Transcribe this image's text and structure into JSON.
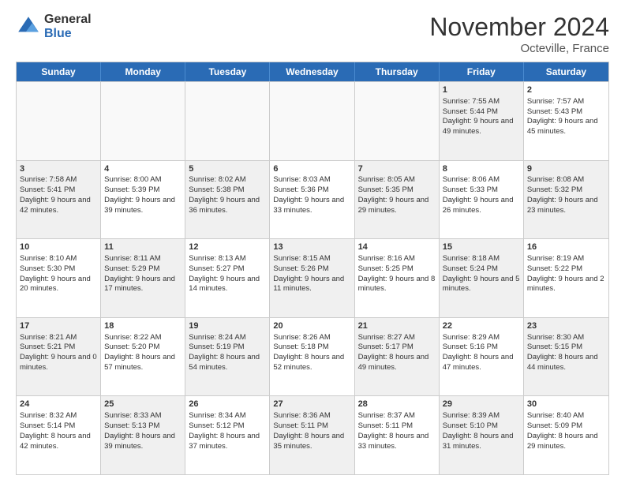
{
  "logo": {
    "general": "General",
    "blue": "Blue"
  },
  "header": {
    "month": "November 2024",
    "location": "Octeville, France"
  },
  "weekdays": [
    "Sunday",
    "Monday",
    "Tuesday",
    "Wednesday",
    "Thursday",
    "Friday",
    "Saturday"
  ],
  "rows": [
    [
      {
        "day": "",
        "info": "",
        "empty": true
      },
      {
        "day": "",
        "info": "",
        "empty": true
      },
      {
        "day": "",
        "info": "",
        "empty": true
      },
      {
        "day": "",
        "info": "",
        "empty": true
      },
      {
        "day": "",
        "info": "",
        "empty": true
      },
      {
        "day": "1",
        "info": "Sunrise: 7:55 AM\nSunset: 5:44 PM\nDaylight: 9 hours and 49 minutes.",
        "shaded": true
      },
      {
        "day": "2",
        "info": "Sunrise: 7:57 AM\nSunset: 5:43 PM\nDaylight: 9 hours and 45 minutes.",
        "shaded": false
      }
    ],
    [
      {
        "day": "3",
        "info": "Sunrise: 7:58 AM\nSunset: 5:41 PM\nDaylight: 9 hours and 42 minutes.",
        "shaded": true
      },
      {
        "day": "4",
        "info": "Sunrise: 8:00 AM\nSunset: 5:39 PM\nDaylight: 9 hours and 39 minutes.",
        "shaded": false
      },
      {
        "day": "5",
        "info": "Sunrise: 8:02 AM\nSunset: 5:38 PM\nDaylight: 9 hours and 36 minutes.",
        "shaded": true
      },
      {
        "day": "6",
        "info": "Sunrise: 8:03 AM\nSunset: 5:36 PM\nDaylight: 9 hours and 33 minutes.",
        "shaded": false
      },
      {
        "day": "7",
        "info": "Sunrise: 8:05 AM\nSunset: 5:35 PM\nDaylight: 9 hours and 29 minutes.",
        "shaded": true
      },
      {
        "day": "8",
        "info": "Sunrise: 8:06 AM\nSunset: 5:33 PM\nDaylight: 9 hours and 26 minutes.",
        "shaded": false
      },
      {
        "day": "9",
        "info": "Sunrise: 8:08 AM\nSunset: 5:32 PM\nDaylight: 9 hours and 23 minutes.",
        "shaded": true
      }
    ],
    [
      {
        "day": "10",
        "info": "Sunrise: 8:10 AM\nSunset: 5:30 PM\nDaylight: 9 hours and 20 minutes.",
        "shaded": false
      },
      {
        "day": "11",
        "info": "Sunrise: 8:11 AM\nSunset: 5:29 PM\nDaylight: 9 hours and 17 minutes.",
        "shaded": true
      },
      {
        "day": "12",
        "info": "Sunrise: 8:13 AM\nSunset: 5:27 PM\nDaylight: 9 hours and 14 minutes.",
        "shaded": false
      },
      {
        "day": "13",
        "info": "Sunrise: 8:15 AM\nSunset: 5:26 PM\nDaylight: 9 hours and 11 minutes.",
        "shaded": true
      },
      {
        "day": "14",
        "info": "Sunrise: 8:16 AM\nSunset: 5:25 PM\nDaylight: 9 hours and 8 minutes.",
        "shaded": false
      },
      {
        "day": "15",
        "info": "Sunrise: 8:18 AM\nSunset: 5:24 PM\nDaylight: 9 hours and 5 minutes.",
        "shaded": true
      },
      {
        "day": "16",
        "info": "Sunrise: 8:19 AM\nSunset: 5:22 PM\nDaylight: 9 hours and 2 minutes.",
        "shaded": false
      }
    ],
    [
      {
        "day": "17",
        "info": "Sunrise: 8:21 AM\nSunset: 5:21 PM\nDaylight: 9 hours and 0 minutes.",
        "shaded": true
      },
      {
        "day": "18",
        "info": "Sunrise: 8:22 AM\nSunset: 5:20 PM\nDaylight: 8 hours and 57 minutes.",
        "shaded": false
      },
      {
        "day": "19",
        "info": "Sunrise: 8:24 AM\nSunset: 5:19 PM\nDaylight: 8 hours and 54 minutes.",
        "shaded": true
      },
      {
        "day": "20",
        "info": "Sunrise: 8:26 AM\nSunset: 5:18 PM\nDaylight: 8 hours and 52 minutes.",
        "shaded": false
      },
      {
        "day": "21",
        "info": "Sunrise: 8:27 AM\nSunset: 5:17 PM\nDaylight: 8 hours and 49 minutes.",
        "shaded": true
      },
      {
        "day": "22",
        "info": "Sunrise: 8:29 AM\nSunset: 5:16 PM\nDaylight: 8 hours and 47 minutes.",
        "shaded": false
      },
      {
        "day": "23",
        "info": "Sunrise: 8:30 AM\nSunset: 5:15 PM\nDaylight: 8 hours and 44 minutes.",
        "shaded": true
      }
    ],
    [
      {
        "day": "24",
        "info": "Sunrise: 8:32 AM\nSunset: 5:14 PM\nDaylight: 8 hours and 42 minutes.",
        "shaded": false
      },
      {
        "day": "25",
        "info": "Sunrise: 8:33 AM\nSunset: 5:13 PM\nDaylight: 8 hours and 39 minutes.",
        "shaded": true
      },
      {
        "day": "26",
        "info": "Sunrise: 8:34 AM\nSunset: 5:12 PM\nDaylight: 8 hours and 37 minutes.",
        "shaded": false
      },
      {
        "day": "27",
        "info": "Sunrise: 8:36 AM\nSunset: 5:11 PM\nDaylight: 8 hours and 35 minutes.",
        "shaded": true
      },
      {
        "day": "28",
        "info": "Sunrise: 8:37 AM\nSunset: 5:11 PM\nDaylight: 8 hours and 33 minutes.",
        "shaded": false
      },
      {
        "day": "29",
        "info": "Sunrise: 8:39 AM\nSunset: 5:10 PM\nDaylight: 8 hours and 31 minutes.",
        "shaded": true
      },
      {
        "day": "30",
        "info": "Sunrise: 8:40 AM\nSunset: 5:09 PM\nDaylight: 8 hours and 29 minutes.",
        "shaded": false
      }
    ]
  ]
}
